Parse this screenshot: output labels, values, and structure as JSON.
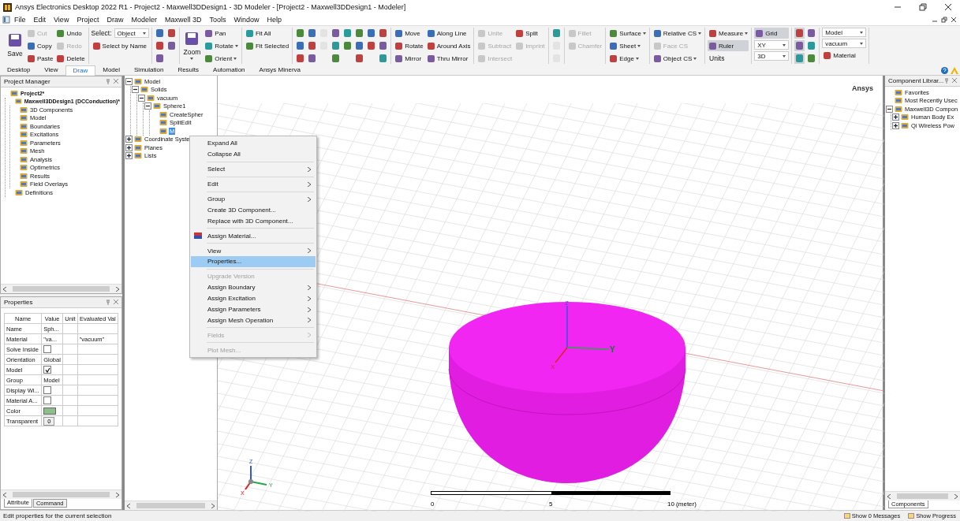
{
  "window": {
    "title": "Ansys Electronics Desktop 2022 R1 - Project2 - Maxwell3DDesign1 - 3D Modeler - [Project2 - Maxwell3DDesign1 - Modeler]"
  },
  "menu": [
    "File",
    "Edit",
    "View",
    "Project",
    "Draw",
    "Modeler",
    "Maxwell 3D",
    "Tools",
    "Window",
    "Help"
  ],
  "ribbon": {
    "groups": [
      {
        "columns": [
          [
            {
              "kind": "large",
              "label": "Save"
            }
          ],
          [
            {
              "kind": "small",
              "label": "Cut",
              "disabled": true
            },
            {
              "kind": "small",
              "label": "Copy"
            },
            {
              "kind": "small",
              "label": "Paste"
            }
          ],
          [
            {
              "kind": "small",
              "label": "Undo"
            },
            {
              "kind": "small",
              "label": "Redo",
              "disabled": true
            },
            {
              "kind": "small",
              "label": "Delete"
            }
          ]
        ]
      },
      {
        "columns": [
          [
            {
              "kind": "select",
              "label": "Select:",
              "value": "Object"
            },
            {
              "kind": "small",
              "label": "Select by Name"
            }
          ]
        ]
      },
      {
        "columns": [
          [
            {
              "kind": "icon"
            },
            {
              "kind": "icon"
            },
            {
              "kind": "icon"
            }
          ],
          [
            {
              "kind": "icon"
            },
            {
              "kind": "icon"
            }
          ]
        ]
      },
      {
        "columns": [
          [
            {
              "kind": "large",
              "label": "Zoom",
              "dropdown": true
            }
          ],
          [
            {
              "kind": "small",
              "label": "Pan"
            },
            {
              "kind": "small",
              "label": "Rotate",
              "dropdown": true
            },
            {
              "kind": "small",
              "label": "Orient",
              "dropdown": true
            }
          ]
        ]
      },
      {
        "columns": [
          [
            {
              "kind": "small",
              "label": "Fit All"
            },
            {
              "kind": "small",
              "label": "Fit Selected"
            }
          ]
        ]
      },
      {
        "columns": [
          [
            {
              "kind": "icon"
            },
            {
              "kind": "icon"
            },
            {
              "kind": "icon"
            }
          ],
          [
            {
              "kind": "icon"
            },
            {
              "kind": "icon"
            },
            {
              "kind": "icon"
            }
          ],
          [
            {
              "kind": "icon",
              "disabled": true
            },
            {
              "kind": "icon",
              "disabled": true
            }
          ],
          [
            {
              "kind": "icon"
            },
            {
              "kind": "icon"
            },
            {
              "kind": "icon"
            }
          ],
          [
            {
              "kind": "icon"
            },
            {
              "kind": "icon"
            }
          ],
          [
            {
              "kind": "icon"
            },
            {
              "kind": "icon"
            },
            {
              "kind": "icon"
            }
          ],
          [
            {
              "kind": "icon"
            },
            {
              "kind": "icon"
            }
          ],
          [
            {
              "kind": "icon"
            },
            {
              "kind": "icon"
            },
            {
              "kind": "icon"
            }
          ]
        ]
      },
      {
        "columns": [
          [
            {
              "kind": "small",
              "label": "Move"
            },
            {
              "kind": "small",
              "label": "Rotate"
            },
            {
              "kind": "small",
              "label": "Mirror"
            }
          ],
          [
            {
              "kind": "small",
              "label": "Along Line"
            },
            {
              "kind": "small",
              "label": "Around Axis"
            },
            {
              "kind": "small",
              "label": "Thru Mirror"
            }
          ]
        ]
      },
      {
        "columns": [
          [
            {
              "kind": "small",
              "label": "Unite",
              "disabled": true
            },
            {
              "kind": "small",
              "label": "Subtract",
              "disabled": true
            },
            {
              "kind": "small",
              "label": "Intersect",
              "disabled": true
            }
          ],
          [
            {
              "kind": "small",
              "label": "Split"
            },
            {
              "kind": "small",
              "label": "Imprint",
              "disabled": true
            }
          ]
        ]
      },
      {
        "columns": [
          [
            {
              "kind": "icon"
            },
            {
              "kind": "icon",
              "disabled": true
            },
            {
              "kind": "icon",
              "disabled": true
            }
          ]
        ]
      },
      {
        "columns": [
          [
            {
              "kind": "small",
              "label": "Fillet",
              "disabled": true
            },
            {
              "kind": "small",
              "label": "Chamfer",
              "disabled": true
            }
          ]
        ]
      },
      {
        "columns": [
          [
            {
              "kind": "small",
              "label": "Surface",
              "dropdown": true
            },
            {
              "kind": "small",
              "label": "Sheet",
              "dropdown": true
            },
            {
              "kind": "small",
              "label": "Edge",
              "dropdown": true
            }
          ]
        ]
      },
      {
        "columns": [
          [
            {
              "kind": "small",
              "label": "Relative CS",
              "dropdown": true
            },
            {
              "kind": "small",
              "label": "Face CS",
              "disabled": true
            },
            {
              "kind": "small",
              "label": "Object CS",
              "dropdown": true
            }
          ]
        ]
      },
      {
        "columns": [
          [
            {
              "kind": "small",
              "label": "Measure",
              "dropdown": true
            },
            {
              "kind": "small",
              "label": "Ruler",
              "on": true
            },
            {
              "kind": "text",
              "label": "Units"
            }
          ]
        ]
      },
      {
        "columns": [
          [
            {
              "kind": "small",
              "label": "Grid",
              "on": true
            },
            {
              "kind": "combo",
              "value": "XY"
            },
            {
              "kind": "combo",
              "value": "3D"
            }
          ]
        ]
      },
      {
        "columns": [
          [
            {
              "kind": "icon",
              "on": true
            },
            {
              "kind": "icon",
              "on": true
            },
            {
              "kind": "icon",
              "on": true
            }
          ],
          [
            {
              "kind": "icon"
            },
            {
              "kind": "icon"
            },
            {
              "kind": "icon"
            }
          ]
        ]
      },
      {
        "columns": [
          [
            {
              "kind": "combo",
              "value": "Model"
            },
            {
              "kind": "combo",
              "value": "vacuum"
            },
            {
              "kind": "small",
              "label": "Material"
            }
          ]
        ]
      }
    ]
  },
  "ribbon_tabs": [
    {
      "label": "Desktop",
      "selected": false
    },
    {
      "label": "View",
      "selected": false
    },
    {
      "label": "Draw",
      "selected": true
    },
    {
      "label": "Model",
      "selected": false
    },
    {
      "label": "Simulation",
      "selected": false
    },
    {
      "label": "Results",
      "selected": false
    },
    {
      "label": "Automation",
      "selected": false
    },
    {
      "label": "Ansys Minerva",
      "selected": false
    }
  ],
  "project_manager": {
    "title": "Project Manager",
    "tree": [
      {
        "label": "Project2*",
        "bold": true,
        "children": [
          {
            "label": "Maxwell3DDesign1 (DCConduction)*",
            "bold": true,
            "children": [
              {
                "label": "3D Components"
              },
              {
                "label": "Model"
              },
              {
                "label": "Boundaries"
              },
              {
                "label": "Excitations"
              },
              {
                "label": "Parameters"
              },
              {
                "label": "Mesh"
              },
              {
                "label": "Analysis"
              },
              {
                "label": "Optimetrics"
              },
              {
                "label": "Results"
              },
              {
                "label": "Field Overlays"
              }
            ]
          },
          {
            "label": "Definitions"
          }
        ]
      }
    ]
  },
  "properties": {
    "title": "Properties",
    "columns": [
      "Name",
      "Value",
      "Unit",
      "Evaluated Val"
    ],
    "rows": [
      {
        "name": "Name",
        "kind": "text",
        "value": "Sph..."
      },
      {
        "name": "Material",
        "kind": "text",
        "value": "\"va...",
        "evaluated": "\"vacuum\""
      },
      {
        "name": "Solve Inside",
        "kind": "checkbox",
        "checked": false
      },
      {
        "name": "Orientation",
        "kind": "text",
        "value": "Global"
      },
      {
        "name": "Model",
        "kind": "checkbox",
        "checked": true
      },
      {
        "name": "Group",
        "kind": "text",
        "value": "Model"
      },
      {
        "name": "Display Wi...",
        "kind": "checkbox",
        "checked": false
      },
      {
        "name": "Material A...",
        "kind": "checkbox",
        "checked": false
      },
      {
        "name": "Color",
        "kind": "color",
        "color": "#8cbf8c"
      },
      {
        "name": "Transparent",
        "kind": "button",
        "value": "0"
      }
    ],
    "tabs": [
      {
        "label": "Attribute",
        "selected": true
      },
      {
        "label": "Command",
        "selected": false
      }
    ]
  },
  "model_tree": [
    {
      "label": "Model",
      "expanded": true,
      "children": [
        {
          "label": "Solids",
          "expanded": true,
          "children": [
            {
              "label": "vacuum",
              "expanded": true,
              "children": [
                {
                  "label": "Sphere1",
                  "expanded": true,
                  "children": [
                    {
                      "label": "CreateSpher",
                      "selected": false
                    },
                    {
                      "label": "SplitEdit",
                      "selected": false
                    },
                    {
                      "label": "M",
                      "selected": true
                    }
                  ]
                }
              ]
            }
          ]
        }
      ]
    },
    {
      "label": "Coordinate Syste",
      "expanded": false
    },
    {
      "label": "Planes",
      "expanded": false
    },
    {
      "label": "Lists",
      "expanded": false
    }
  ],
  "viewport": {
    "brand": "Ansys",
    "triad_labels": [
      "Z",
      "Y",
      "X"
    ],
    "corner_triad_labels": [
      "Z",
      "Y",
      "X"
    ],
    "ruler_labels": [
      "0",
      "5",
      "10 (meter)"
    ]
  },
  "context_menu": [
    {
      "kind": "item",
      "label": "Expand All"
    },
    {
      "kind": "item",
      "label": "Collapse All"
    },
    {
      "kind": "separator"
    },
    {
      "kind": "item",
      "label": "Select",
      "submenu": true
    },
    {
      "kind": "separator"
    },
    {
      "kind": "item",
      "label": "Edit",
      "submenu": true
    },
    {
      "kind": "separator"
    },
    {
      "kind": "item",
      "label": "Group",
      "submenu": true
    },
    {
      "kind": "item",
      "label": "Create 3D Component..."
    },
    {
      "kind": "item",
      "label": "Replace with 3D Component..."
    },
    {
      "kind": "separator"
    },
    {
      "kind": "item",
      "label": "Assign Material...",
      "icon": true
    },
    {
      "kind": "separator"
    },
    {
      "kind": "item",
      "label": "View",
      "submenu": true
    },
    {
      "kind": "item",
      "label": "Properties...",
      "selected": true
    },
    {
      "kind": "separator"
    },
    {
      "kind": "item",
      "label": "Upgrade Version",
      "disabled": true
    },
    {
      "kind": "item",
      "label": "Assign Boundary",
      "submenu": true
    },
    {
      "kind": "item",
      "label": "Assign Excitation",
      "submenu": true
    },
    {
      "kind": "item",
      "label": "Assign Parameters",
      "submenu": true
    },
    {
      "kind": "item",
      "label": "Assign Mesh Operation",
      "submenu": true
    },
    {
      "kind": "separator"
    },
    {
      "kind": "item",
      "label": "Fields",
      "submenu": true,
      "disabled": true
    },
    {
      "kind": "separator"
    },
    {
      "kind": "item",
      "label": "Plot Mesh...",
      "disabled": true
    }
  ],
  "component_library": {
    "title": "Component Librar...",
    "tree": [
      {
        "label": "Favorites"
      },
      {
        "label": "Most Recently Usec"
      },
      {
        "label": "Maxwell3D Compon",
        "expanded": true,
        "children": [
          {
            "label": "Human Body Ex",
            "expanded": false
          },
          {
            "label": "Qi Wireless Pow",
            "expanded": false
          }
        ]
      }
    ],
    "tabs": [
      {
        "label": "Components",
        "selected": true
      }
    ]
  },
  "status_bar": {
    "text": "Edit properties for the current selection",
    "buttons": [
      "Show 0 Messages",
      "Show Progress"
    ]
  }
}
